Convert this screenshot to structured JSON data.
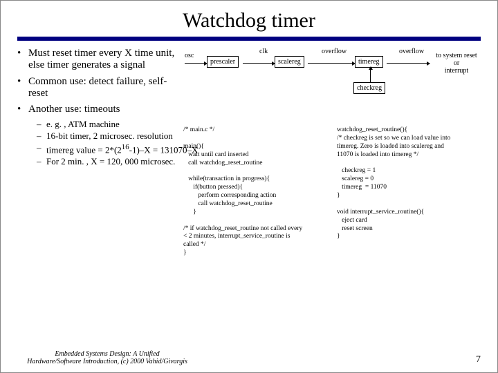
{
  "title": "Watchdog timer",
  "bullets": {
    "b1": "Must reset timer every X time unit, else timer generates a signal",
    "b2": "Common use: detect failure, self-reset",
    "b3": "Another use: timeouts",
    "b3a": "e. g. , ATM machine",
    "b3b": "16-bit timer, 2 microsec. resolution",
    "b3c_pre": "timereg value = 2*(2",
    "b3c_sup": "16",
    "b3c_post": "-1)–X = 131070–X",
    "b3d": "For 2 min. , X = 120, 000 microsec."
  },
  "diagram": {
    "osc": "osc",
    "clk": "clk",
    "overflow1": "overflow",
    "overflow2": "overflow",
    "prescaler": "prescaler",
    "scalereg": "scalereg",
    "timereg": "timereg",
    "checkreg": "checkreg",
    "note": "to system reset\nor\ninterrupt"
  },
  "code_left": "/* main.c */\n\nmain(){\n   wait until card inserted\n   call watchdog_reset_routine\n\n   while(transaction in progress){\n      if(button pressed){\n         perform corresponding action\n         call watchdog_reset_routine\n      }\n\n/* if watchdog_reset_routine not called every\n< 2 minutes, interrupt_service_routine is\ncalled */\n}",
  "code_right": "watchdog_reset_routine(){\n/* checkreg is set so we can load value into\ntimereg. Zero is loaded into scalereg and\n11070 is loaded into timereg */\n\n   checkreg = 1\n   scalereg = 0\n   timereg  = 11070\n}\n\nvoid interrupt_service_routine(){\n   eject card\n   reset screen\n}",
  "footer": {
    "text": "Embedded Systems Design: A Unified\nHardware/Software Introduction, (c) 2000 Vahid/Givargis",
    "page": "7"
  }
}
